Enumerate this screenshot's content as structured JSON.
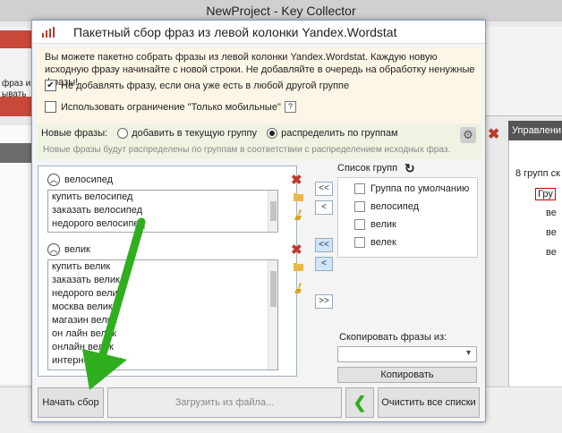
{
  "window": {
    "title": "NewProject - Key Collector"
  },
  "background": {
    "left_fragments": [
      "фраз из",
      "ывать"
    ],
    "right_header": "Управлени",
    "right_group_count": "8 групп ск",
    "right_items": [
      "Гру",
      "ве",
      "ве",
      "ве"
    ]
  },
  "dialog": {
    "title": "Пакетный сбор фраз из левой колонки Yandex.Wordstat",
    "notice": "Вы можете пакетно собрать фразы из левой колонки Yandex.Wordstat. Каждую новую исходную фразу начинайте с новой строки. Не добавляйте в очередь на обработку ненужные фразы!",
    "cb_no_duplicates": "Не добавлять фразу, если она уже есть в любой другой группе",
    "cb_mobile_only": "Использовать ограничение \"Только мобильные\"",
    "help_mark": "?",
    "new_phrases_label": "Новые фразы:",
    "radio_current": "добавить в текущую группу",
    "radio_distribute": "распределить по группам",
    "hint": "Новые фразы будут распределены по группам в соответствии с распределением исходных фраз.",
    "groups": [
      {
        "name": "велосипед",
        "phrases": [
          "купить велосипед",
          "заказать велосипед",
          "недорого велосипед"
        ]
      },
      {
        "name": "велик",
        "phrases": [
          "купить велик",
          "заказать велик",
          "недорого велик",
          "москва велик",
          "магазин велик",
          "он лайн велик",
          "онлайн велик",
          "интернет велик"
        ]
      }
    ],
    "move_buttons": [
      "<<",
      "<",
      "<<",
      "<",
      ">>"
    ],
    "group_list_label": "Список групп",
    "group_list": [
      "Группа по умолчанию",
      "велосипед",
      "велик",
      "велек"
    ],
    "copy_label": "Скопировать фразы из:",
    "copy_button": "Копировать",
    "start_button": "Начать сбор",
    "load_button": "Загрузить из файла...",
    "clear_button": "Очистить все списки"
  },
  "colors": {
    "accent": "#c8483b",
    "arrow": "#2fae1e"
  }
}
